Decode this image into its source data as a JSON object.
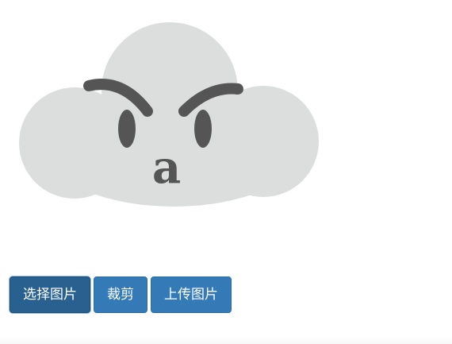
{
  "preview": {
    "avatar_icon": "cloud-face-icon",
    "avatar_letter": "a",
    "cloud_color": "#dcdedd",
    "feature_color": "#555555"
  },
  "toolbar": {
    "select_label": "选择图片",
    "crop_label": "裁剪",
    "upload_label": "上传图片",
    "button_color": "#337ab7",
    "button_active_color": "#286090"
  }
}
